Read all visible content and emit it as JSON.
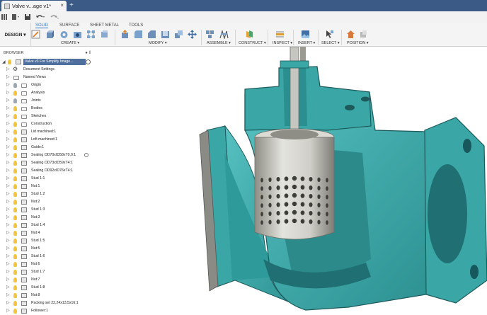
{
  "title_bar": {
    "document_tab": "Valve v...age v1*",
    "close_glyph": "×",
    "new_tab_glyph": "+"
  },
  "workspace": {
    "label": "DESIGN ▾"
  },
  "ribbon": {
    "tabs": [
      {
        "label": "SOLID",
        "active": true
      },
      {
        "label": "SURFACE",
        "active": false
      },
      {
        "label": "SHEET METAL",
        "active": false
      },
      {
        "label": "TOOLS",
        "active": false
      }
    ],
    "groups": [
      {
        "label": "CREATE ▾"
      },
      {
        "label": "MODIFY ▾"
      },
      {
        "label": "ASSEMBLE ▾"
      },
      {
        "label": "CONSTRUCT ▾"
      },
      {
        "label": "INSPECT ▾"
      },
      {
        "label": "INSERT ▾"
      },
      {
        "label": "SELECT ▾"
      },
      {
        "label": "POSITION ▾"
      }
    ]
  },
  "browser": {
    "header": "BROWSER",
    "root": "Valve v3 For Simplify Image...",
    "items": [
      {
        "label": "Document Settings",
        "kind": "settings"
      },
      {
        "label": "Named Views",
        "kind": "folder-nobulb"
      },
      {
        "label": "Origin",
        "kind": "folder",
        "bulb": "off"
      },
      {
        "label": "Analysis",
        "kind": "folder",
        "bulb": "on"
      },
      {
        "label": "Joints",
        "kind": "folder",
        "bulb": "off"
      },
      {
        "label": "Bodies",
        "kind": "folder",
        "bulb": "on"
      },
      {
        "label": "Sketches",
        "kind": "folder",
        "bulb": "on"
      },
      {
        "label": "Construction",
        "kind": "folder",
        "bulb": "on"
      },
      {
        "label": "Lid machined:1",
        "kind": "body",
        "bulb": "on"
      },
      {
        "label": "Loft machined:1",
        "kind": "body",
        "bulb": "on"
      },
      {
        "label": "Guide:1",
        "kind": "body",
        "bulb": "on"
      },
      {
        "label": "Sealing OD70xID58xT0,9:1",
        "kind": "body",
        "bulb": "on",
        "marker": true
      },
      {
        "label": "Sealing OD73xID59xT4:1",
        "kind": "body",
        "bulb": "on"
      },
      {
        "label": "Sealing OD92xID76xT4:1",
        "kind": "body",
        "bulb": "on"
      },
      {
        "label": "Stud 1:1",
        "kind": "body",
        "bulb": "on"
      },
      {
        "label": "Nut:1",
        "kind": "body",
        "bulb": "on"
      },
      {
        "label": "Stud 1:2",
        "kind": "body",
        "bulb": "on"
      },
      {
        "label": "Nut:2",
        "kind": "body",
        "bulb": "on"
      },
      {
        "label": "Stud 1:3",
        "kind": "body",
        "bulb": "on"
      },
      {
        "label": "Nut:3",
        "kind": "body",
        "bulb": "on"
      },
      {
        "label": "Stud 1:4",
        "kind": "body",
        "bulb": "on"
      },
      {
        "label": "Nut:4",
        "kind": "body",
        "bulb": "on"
      },
      {
        "label": "Stud 1:5",
        "kind": "body",
        "bulb": "on"
      },
      {
        "label": "Nut:5",
        "kind": "body",
        "bulb": "on"
      },
      {
        "label": "Stud 1:6",
        "kind": "body",
        "bulb": "on"
      },
      {
        "label": "Nut:6",
        "kind": "body",
        "bulb": "on"
      },
      {
        "label": "Stud 1:7",
        "kind": "body",
        "bulb": "on"
      },
      {
        "label": "Nut:7",
        "kind": "body",
        "bulb": "on"
      },
      {
        "label": "Stud 1:8",
        "kind": "body",
        "bulb": "on"
      },
      {
        "label": "Nut:8",
        "kind": "body",
        "bulb": "on"
      },
      {
        "label": "Packing set 22,24x13,5x16:1",
        "kind": "body",
        "bulb": "on"
      },
      {
        "label": "Follower:1",
        "kind": "body",
        "bulb": "on"
      }
    ]
  },
  "colors": {
    "titlebar": "#3b5b86",
    "accent": "#2c7ad6",
    "valve_body": "#3aa7a6",
    "valve_body_dark": "#1f6f73",
    "cage_metal": "#c9c9c2",
    "root_highlight": "#4f6f9e"
  },
  "icons": {
    "app_logo": "fusion-logo-icon",
    "file": "file-icon",
    "save": "save-icon",
    "undo": "undo-icon",
    "redo": "redo-icon",
    "grid": "data-panel-icon",
    "lightbulb": "lightbulb-icon",
    "folder": "folder-icon",
    "component": "component-body-icon"
  }
}
